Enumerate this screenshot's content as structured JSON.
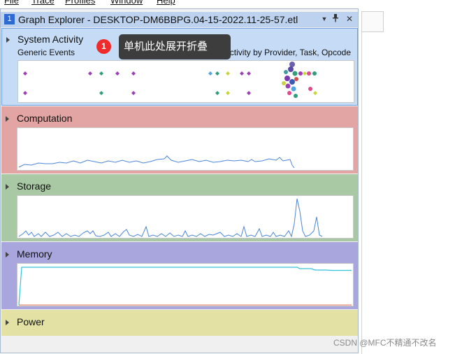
{
  "menu": {
    "items": [
      "File",
      "Trace",
      "Profiles",
      "Window",
      "Help"
    ]
  },
  "window": {
    "tab_number": "1",
    "title": "Graph Explorer - DESKTOP-DM6BBPG.04-15-2022.11-25-57.etl",
    "dropdown_glyph": "▼",
    "pin_glyph": "📌",
    "close_glyph": "✕"
  },
  "sections": {
    "system_activity": {
      "title": "System Activity",
      "subtitle": "Generic Events",
      "graph_label": "Activity by Provider, Task, Opcode",
      "bg": "#c6dbf5"
    },
    "computation": {
      "title": "Computation",
      "bg": "#e2a5a3"
    },
    "storage": {
      "title": "Storage",
      "bg": "#a9c8a4"
    },
    "memory": {
      "title": "Memory",
      "bg": "#a9a6dd"
    },
    "power": {
      "title": "Power",
      "bg": "#e3e2a4"
    }
  },
  "tooltip": {
    "badge": "1",
    "text": "单机此处展开折叠"
  },
  "watermark": "CSDN @MFC不精通不改名",
  "colors": {
    "line": "#4a86d8",
    "memory_line": "#33c3db",
    "accent": "#2f6ad3"
  }
}
